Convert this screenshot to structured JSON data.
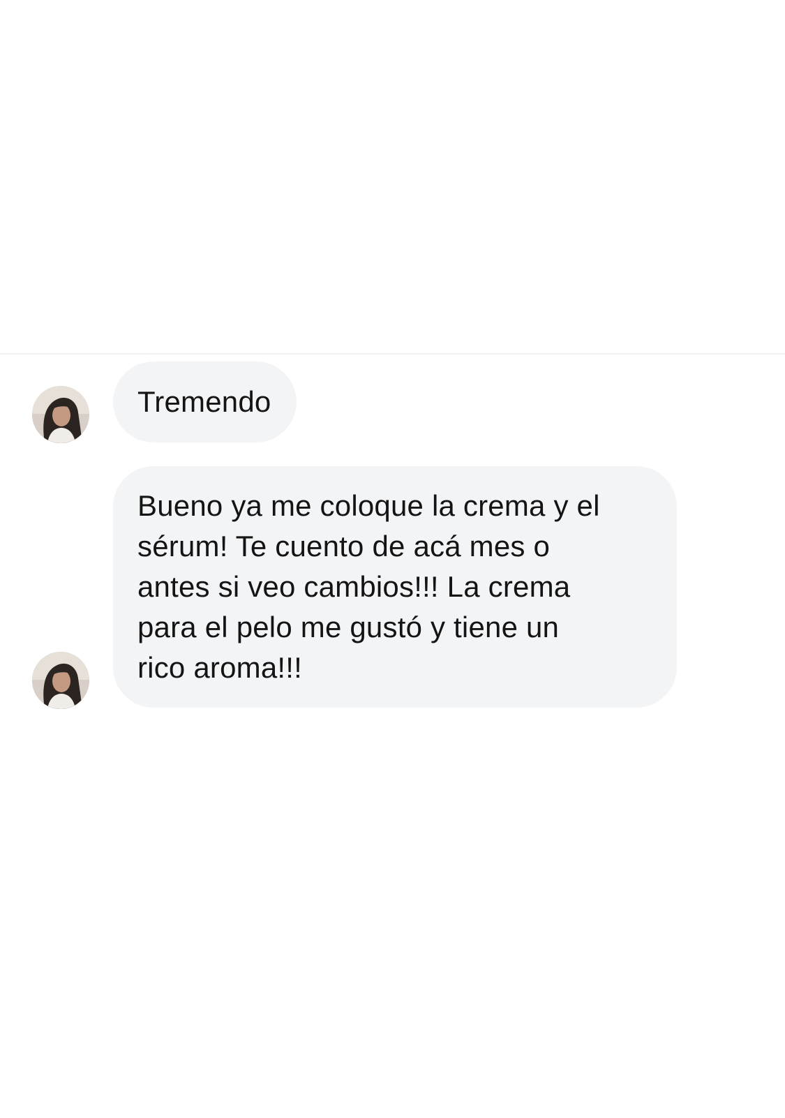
{
  "conversation": {
    "messages": [
      {
        "sender_avatar": "user-avatar-photo",
        "text": "Tremendo"
      },
      {
        "sender_avatar": "user-avatar-photo",
        "lines": [
          "Bueno ya me coloque la crema y el",
          "sérum! Te cuento de acá mes o",
          "antes si veo cambios!!! La crema",
          "para el pelo me gustó y tiene un",
          "rico aroma!!!"
        ]
      }
    ]
  },
  "colors": {
    "background": "#ffffff",
    "bubble_incoming": "#f3f4f6",
    "text": "#141414",
    "divider": "#f1f2f4"
  }
}
